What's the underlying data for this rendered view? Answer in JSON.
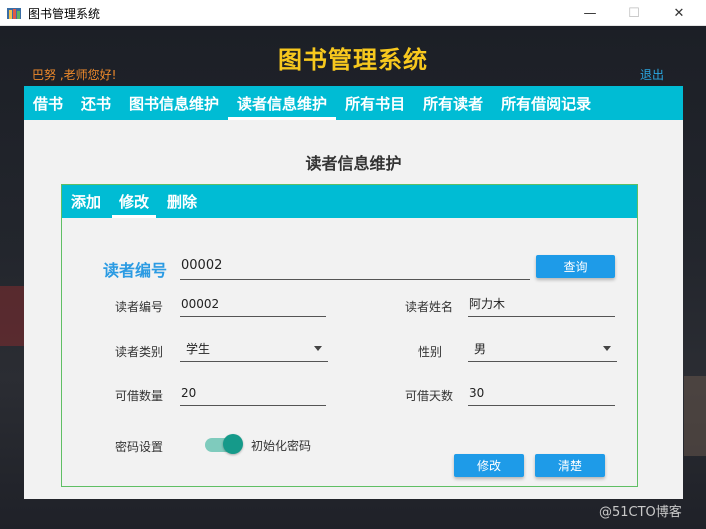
{
  "window": {
    "title": "图书管理系统",
    "minimize": "—",
    "maximize": "☐",
    "close": "✕"
  },
  "header": {
    "title": "图书管理系统",
    "greeting": "巴努 ,老师您好!",
    "logout": "退出"
  },
  "nav": {
    "items": [
      "借书",
      "还书",
      "图书信息维护",
      "读者信息维护",
      "所有书目",
      "所有读者",
      "所有借阅记录"
    ],
    "active": "读者信息维护"
  },
  "page": {
    "title": "读者信息维护"
  },
  "card": {
    "tabs": [
      "添加",
      "修改",
      "删除"
    ],
    "active_tab": "修改"
  },
  "search": {
    "label": "读者编号",
    "value": "00002",
    "button": "查询"
  },
  "form": {
    "reader_id_label": "读者编号",
    "reader_id": "00002",
    "reader_name_label": "读者姓名",
    "reader_name": "阿力木",
    "reader_type_label": "读者类别",
    "reader_type": "学生",
    "gender_label": "性别",
    "gender": "男",
    "borrow_count_label": "可借数量",
    "borrow_count": "20",
    "borrow_days_label": "可借天数",
    "borrow_days": "30",
    "password_label": "密码设置",
    "reset_password_label": "初始化密码",
    "reset_password_on": true,
    "modify_button": "修改",
    "clear_button": "清楚"
  },
  "watermark": "@51CTO博客",
  "colors": {
    "accent": "#00bcd4",
    "title": "#f7c81e",
    "button": "#1e9be8",
    "toggle": "#159a8a"
  }
}
